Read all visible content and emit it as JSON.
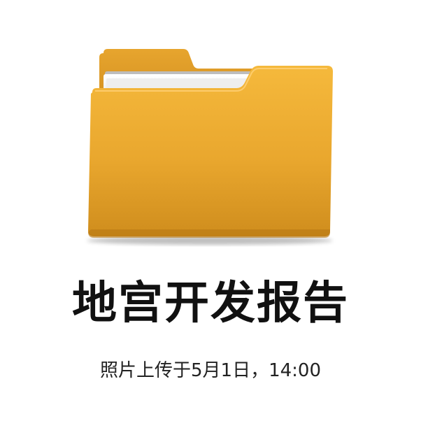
{
  "file": {
    "icon": "folder-icon",
    "title": "地宫开发报告",
    "subtitle": "照片上传于5月1日，14:00"
  },
  "colors": {
    "folder_front_top": "#f5b73a",
    "folder_front_bottom": "#cf8d1d",
    "folder_back": "#d89a25",
    "paper": "#f4f4f4",
    "title_text": "#111111",
    "subtitle_text": "#222222"
  }
}
